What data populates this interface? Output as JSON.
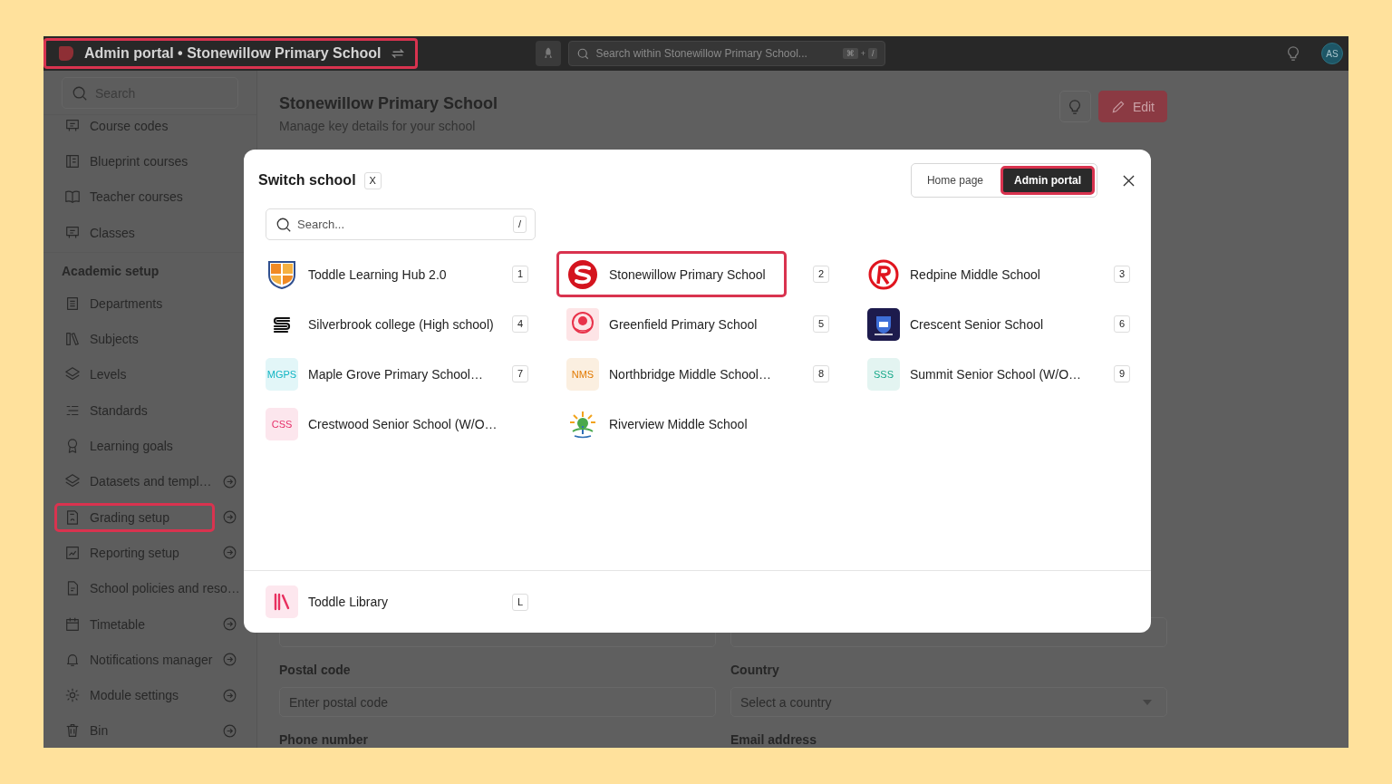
{
  "top_bar": {
    "title": "Admin portal • Stonewillow Primary School",
    "highlighted": true,
    "search_placeholder": "Search within Stonewillow Primary School...",
    "shortcut": [
      "⌘",
      "+",
      "/"
    ],
    "avatar": "AS"
  },
  "sidebar": {
    "search_placeholder": "Search",
    "items": [
      {
        "kind": "item",
        "label": "Course codes",
        "has_arrow": false,
        "highlighted": false
      },
      {
        "kind": "item",
        "label": "Blueprint courses",
        "has_arrow": false,
        "highlighted": false
      },
      {
        "kind": "item",
        "label": "Teacher courses",
        "has_arrow": false,
        "highlighted": false
      },
      {
        "kind": "item",
        "label": "Classes",
        "has_arrow": false,
        "highlighted": false
      },
      {
        "kind": "heading",
        "label": "Academic setup"
      },
      {
        "kind": "item",
        "label": "Departments",
        "has_arrow": false,
        "highlighted": false
      },
      {
        "kind": "item",
        "label": "Subjects",
        "has_arrow": false,
        "highlighted": false
      },
      {
        "kind": "item",
        "label": "Levels",
        "has_arrow": false,
        "highlighted": false
      },
      {
        "kind": "item",
        "label": "Standards",
        "has_arrow": false,
        "highlighted": false
      },
      {
        "kind": "item",
        "label": "Learning goals",
        "has_arrow": false,
        "highlighted": false
      },
      {
        "kind": "item",
        "label": "Datasets and templ…",
        "has_arrow": true,
        "highlighted": false
      },
      {
        "kind": "item",
        "label": "Grading setup",
        "has_arrow": true,
        "highlighted": true
      },
      {
        "kind": "item",
        "label": "Reporting setup",
        "has_arrow": true,
        "highlighted": false
      },
      {
        "kind": "item",
        "label": "School policies and reso…",
        "has_arrow": false,
        "highlighted": false
      },
      {
        "kind": "item",
        "label": "Timetable",
        "has_arrow": true,
        "highlighted": false
      },
      {
        "kind": "item",
        "label": "Notifications manager",
        "has_arrow": true,
        "highlighted": false
      },
      {
        "kind": "item",
        "label": "Module settings",
        "has_arrow": true,
        "highlighted": false
      },
      {
        "kind": "item",
        "label": "Bin",
        "has_arrow": true,
        "highlighted": false
      }
    ]
  },
  "main": {
    "title": "Stonewillow Primary School",
    "subtitle": "Manage key details for your school",
    "edit_button": "Edit",
    "form": [
      {
        "kind": "text"
      },
      {
        "kind": "text"
      },
      {
        "kind": "label",
        "label": "Postal code"
      },
      {
        "kind": "label",
        "label": "Country"
      },
      {
        "kind": "text",
        "placeholder": "Enter postal code"
      },
      {
        "kind": "select",
        "placeholder": "Select a country"
      },
      {
        "kind": "label",
        "label": "Phone number"
      },
      {
        "kind": "label",
        "label": "Email address"
      }
    ]
  },
  "modal": {
    "title": "Switch school",
    "title_key": "X",
    "tabs": [
      {
        "label": "Home page",
        "selected": false,
        "highlighted": false
      },
      {
        "label": "Admin portal",
        "selected": true,
        "highlighted": true
      }
    ],
    "search": {
      "placeholder": "Search...",
      "key": "/"
    },
    "schools": [
      {
        "name": "Toddle Learning Hub 2.0",
        "key": "1",
        "highlighted": false
      },
      {
        "name": "Stonewillow Primary School",
        "key": "2",
        "highlighted": true
      },
      {
        "name": "Redpine Middle School",
        "key": "3",
        "highlighted": false
      },
      {
        "name": "Silverbrook college (High school)",
        "key": "4",
        "highlighted": false
      },
      {
        "name": "Greenfield Primary School",
        "key": "5",
        "highlighted": false
      },
      {
        "name": "Crescent Senior School",
        "key": "6",
        "highlighted": false
      },
      {
        "name": "Maple Grove Primary School…",
        "key": "7",
        "highlighted": false,
        "logo_text": "MGPS",
        "color": "#13b5c4"
      },
      {
        "name": "Northbridge Middle School…",
        "key": "8",
        "highlighted": false,
        "logo_text": "NMS",
        "color": "#e27a00"
      },
      {
        "name": "Summit Senior School (W/O…",
        "key": "9",
        "highlighted": false,
        "logo_text": "SSS",
        "color": "#17a889"
      },
      {
        "name": "Crestwood Senior School (W/O…",
        "highlighted": false,
        "logo_text": "CSS",
        "color": "#e6306a"
      },
      {
        "name": "Riverview Middle School",
        "highlighted": false
      }
    ],
    "footer_item": {
      "name": "Toddle Library",
      "key": "L"
    }
  }
}
